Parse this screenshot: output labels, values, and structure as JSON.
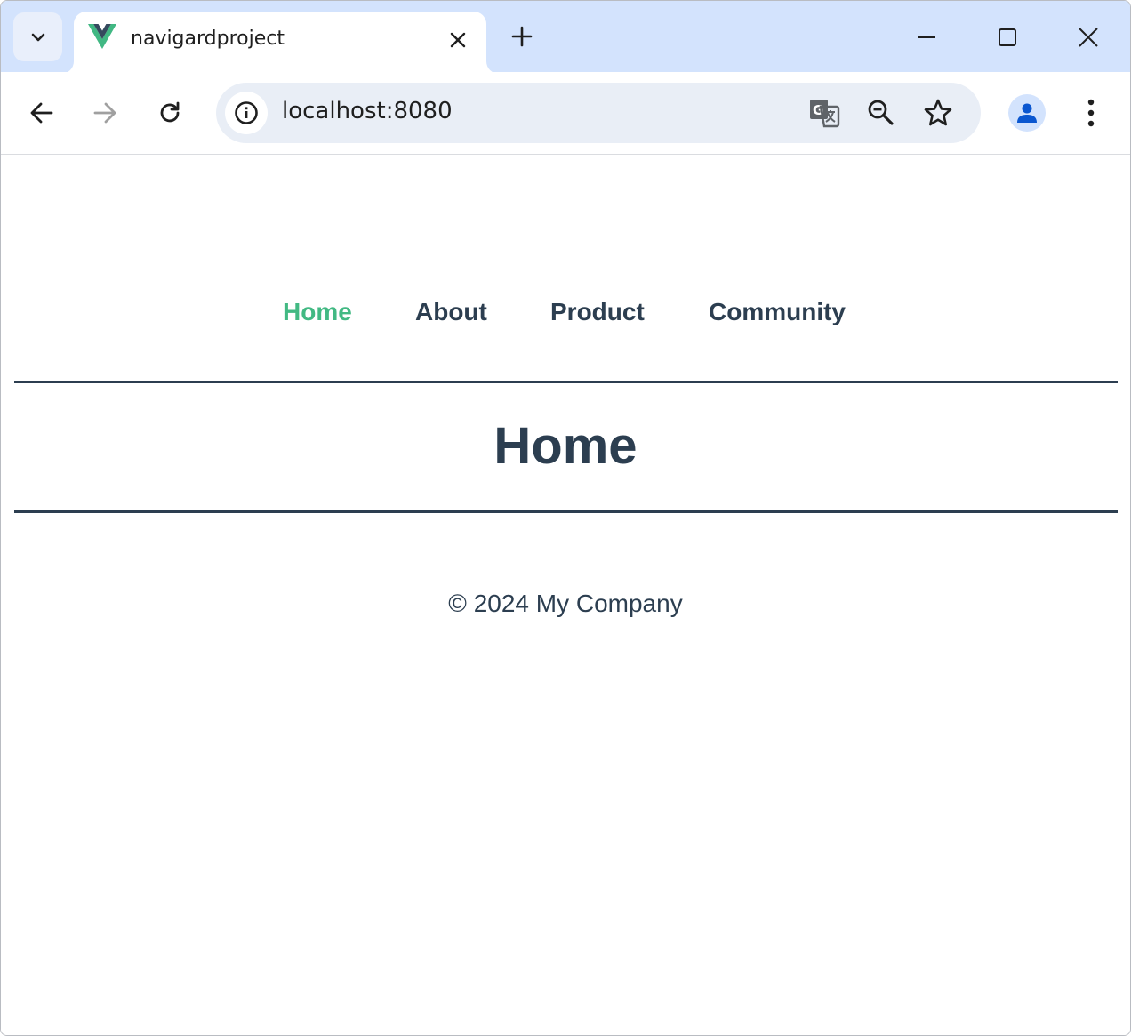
{
  "browser": {
    "tab": {
      "title": "navigardproject",
      "favicon": "vue-logo-icon"
    },
    "address_bar": {
      "url": "localhost:8080"
    },
    "colors": {
      "tabstrip": "#d3e3fd",
      "omnibox": "#e9eef6",
      "profile": "#0b57d0"
    }
  },
  "page": {
    "nav": {
      "links": [
        {
          "label": "Home",
          "active": true
        },
        {
          "label": "About",
          "active": false
        },
        {
          "label": "Product",
          "active": false
        },
        {
          "label": "Community",
          "active": false
        }
      ]
    },
    "heading": "Home",
    "footer": "© 2024 My Company",
    "colors": {
      "text": "#2c3e50",
      "active_link": "#42b983"
    }
  }
}
